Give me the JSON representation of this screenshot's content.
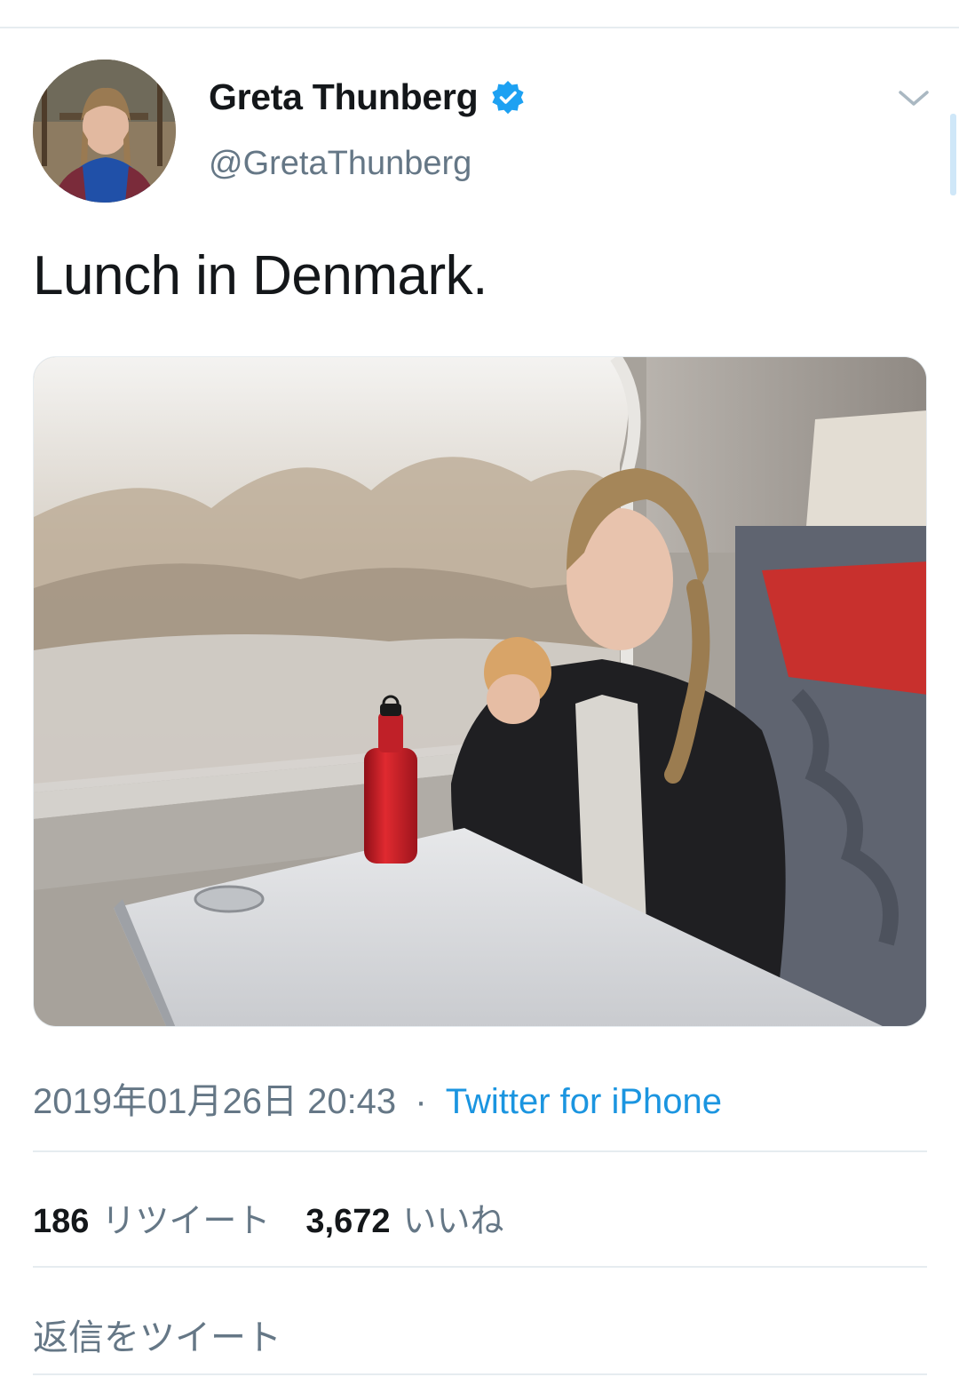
{
  "user": {
    "name": "Greta Thunberg",
    "handle": "@GretaThunberg",
    "verified": true
  },
  "tweet": {
    "text": "Lunch in Denmark.",
    "timestamp": "2019年01月26日 20:43",
    "separator": "·",
    "source": "Twitter for iPhone"
  },
  "stats": {
    "retweets": "186",
    "retweets_label": "リツイート",
    "likes": "3,672",
    "likes_label": "いいね"
  },
  "reply": {
    "placeholder": "返信をツイート"
  },
  "colors": {
    "link": "#1b95e0",
    "verified": "#1da1f2",
    "secondary_text": "#657786",
    "divider": "#e6ecf0"
  },
  "icons": [
    "verified-badge-icon",
    "chevron-down-icon"
  ]
}
